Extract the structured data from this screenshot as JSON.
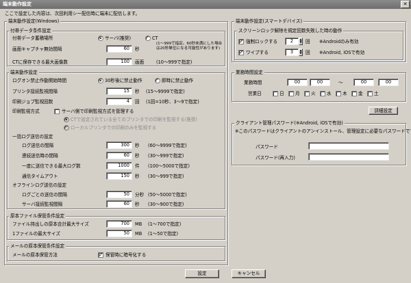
{
  "window": {
    "title": "端末動作設定",
    "close_glyph": "✕"
  },
  "intro": "ここで設定した内容は、次回利用シー配信時に端末に配信します。",
  "windows": {
    "group_label": "端末動作設定(Windows)",
    "temp": {
      "label": "付帯データ条件設定",
      "location_label": "付帯データ蓄積場所",
      "location_options": [
        "サーバ(推奨)",
        "CT"
      ],
      "capture_label": "画面キャプチャ無効間隔",
      "capture_value": "60",
      "capture_unit": "秒",
      "capture_note": "(1～999で指定。60秒未満にした場合は20秒単位になる可能性があります)",
      "ct_max_label": "CTに保存できる最大画像数",
      "ct_max_value": "100",
      "ct_max_unit": "画面",
      "ct_max_note": "(10～999で指定)"
    },
    "terminal": {
      "label": "端末動作設定",
      "login_label": "ログオン禁止作動開始時間",
      "login_options": [
        "30秒後に禁止動作",
        "即時に禁止動作"
      ],
      "print_check_label": "プリンタ接続監視間隔",
      "print_check_value": "15",
      "print_check_unit": "秒",
      "print_check_note": "(15～9999で指定)",
      "print_job_label": "印刷ジョブ監視回数",
      "print_job_value": "4",
      "print_job_unit": "回",
      "print_job_note": "(1回=10秒、3～9で指定)",
      "print_mode_label": "印刷監視方式",
      "print_mode_check": "サーバ側で印刷監視方式を管理する",
      "print_mode_opt1": "CTで設定されている全てのプリンタでの印刷を監視する(推奨)",
      "print_mode_opt2": "ローカルプリンタでの印刷のみを監視する",
      "bulk_label": "一括ログ送信の設定",
      "log_interval_label": "ログ送信の間隔",
      "log_interval_value": "300",
      "log_interval_unit": "秒",
      "log_interval_note": "(60～9999で指定)",
      "retry_label": "連続送信時の間隔",
      "retry_value": "60",
      "retry_unit": "秒",
      "retry_note": "(30～999で指定)",
      "max_logs_label": "一度に送信できる最大ログ数",
      "max_logs_value": "1000",
      "max_logs_unit": "件",
      "max_logs_note": "(100～5000で指定)",
      "timeout_label": "通信タイムアウト",
      "timeout_value": "150",
      "timeout_unit": "秒",
      "timeout_note": "(30～999で指定)",
      "offline_label": "オフラインログ送信の設定",
      "offline_interval_label": "ログごとの送信の間隔",
      "offline_interval_value": "50",
      "offline_interval_unit": "分秒",
      "offline_interval_note": "(50～5000で指定)",
      "server_conn_label": "サーバ接続監視間隔",
      "server_conn_value": "60",
      "server_conn_unit": "秒",
      "server_conn_note": "(30～900で指定)"
    },
    "original": {
      "label": "原本ファイル保管条件設定",
      "max_total_label": "ファイル持出しの原本合計最大サイズ",
      "max_total_value": "700",
      "max_total_unit": "MB",
      "max_total_note": "(1～700で指定)",
      "max_file_label": "1ファイルの最大サイズ",
      "max_file_value": "50",
      "max_file_unit": "MB",
      "max_file_note": "(1～50で指定)"
    },
    "mail": {
      "label": "メールの原本保管条件設定",
      "method_label": "メールの原本保管方法",
      "method_check": "保管時に暗号化する"
    }
  },
  "smart": {
    "group_label": "端末動作設定(スマートデバイス)",
    "screenlock": {
      "label": "スクリーンロック解除を規定回数失敗した時の動作",
      "force_lock_label": "強制ロックする",
      "force_lock_value": "2",
      "force_lock_unit": "回",
      "force_lock_note": "※Androidのみ有効",
      "wipe_label": "ワイプする",
      "wipe_value": "3",
      "wipe_unit": "回",
      "wipe_note": "※Android, iOSで有効"
    },
    "hours": {
      "label": "業務時間設定",
      "time_label": "業務時間",
      "from_h": "00",
      "from_m": "00",
      "to_h": "00",
      "to_m": "00",
      "tilde": "～",
      "days_label": "営業日",
      "days": [
        "日",
        "月",
        "火",
        "水",
        "木",
        "金",
        "土"
      ],
      "detail_button": "詳細設定"
    },
    "client": {
      "label": "クライアント管理パスワード(※Android, iOSで有効)",
      "note": "※このパスワードはクライアントのアンインストール、管理設定に必要なパスワードです。",
      "password_label": "パスワード",
      "password_again_label": "パスワード(再入力)"
    }
  },
  "buttons": {
    "ok": "設定",
    "cancel": "キャンセル"
  },
  "colors": {
    "window_bg": "#d4d0c8",
    "titlebar": "#7a7a7a"
  }
}
